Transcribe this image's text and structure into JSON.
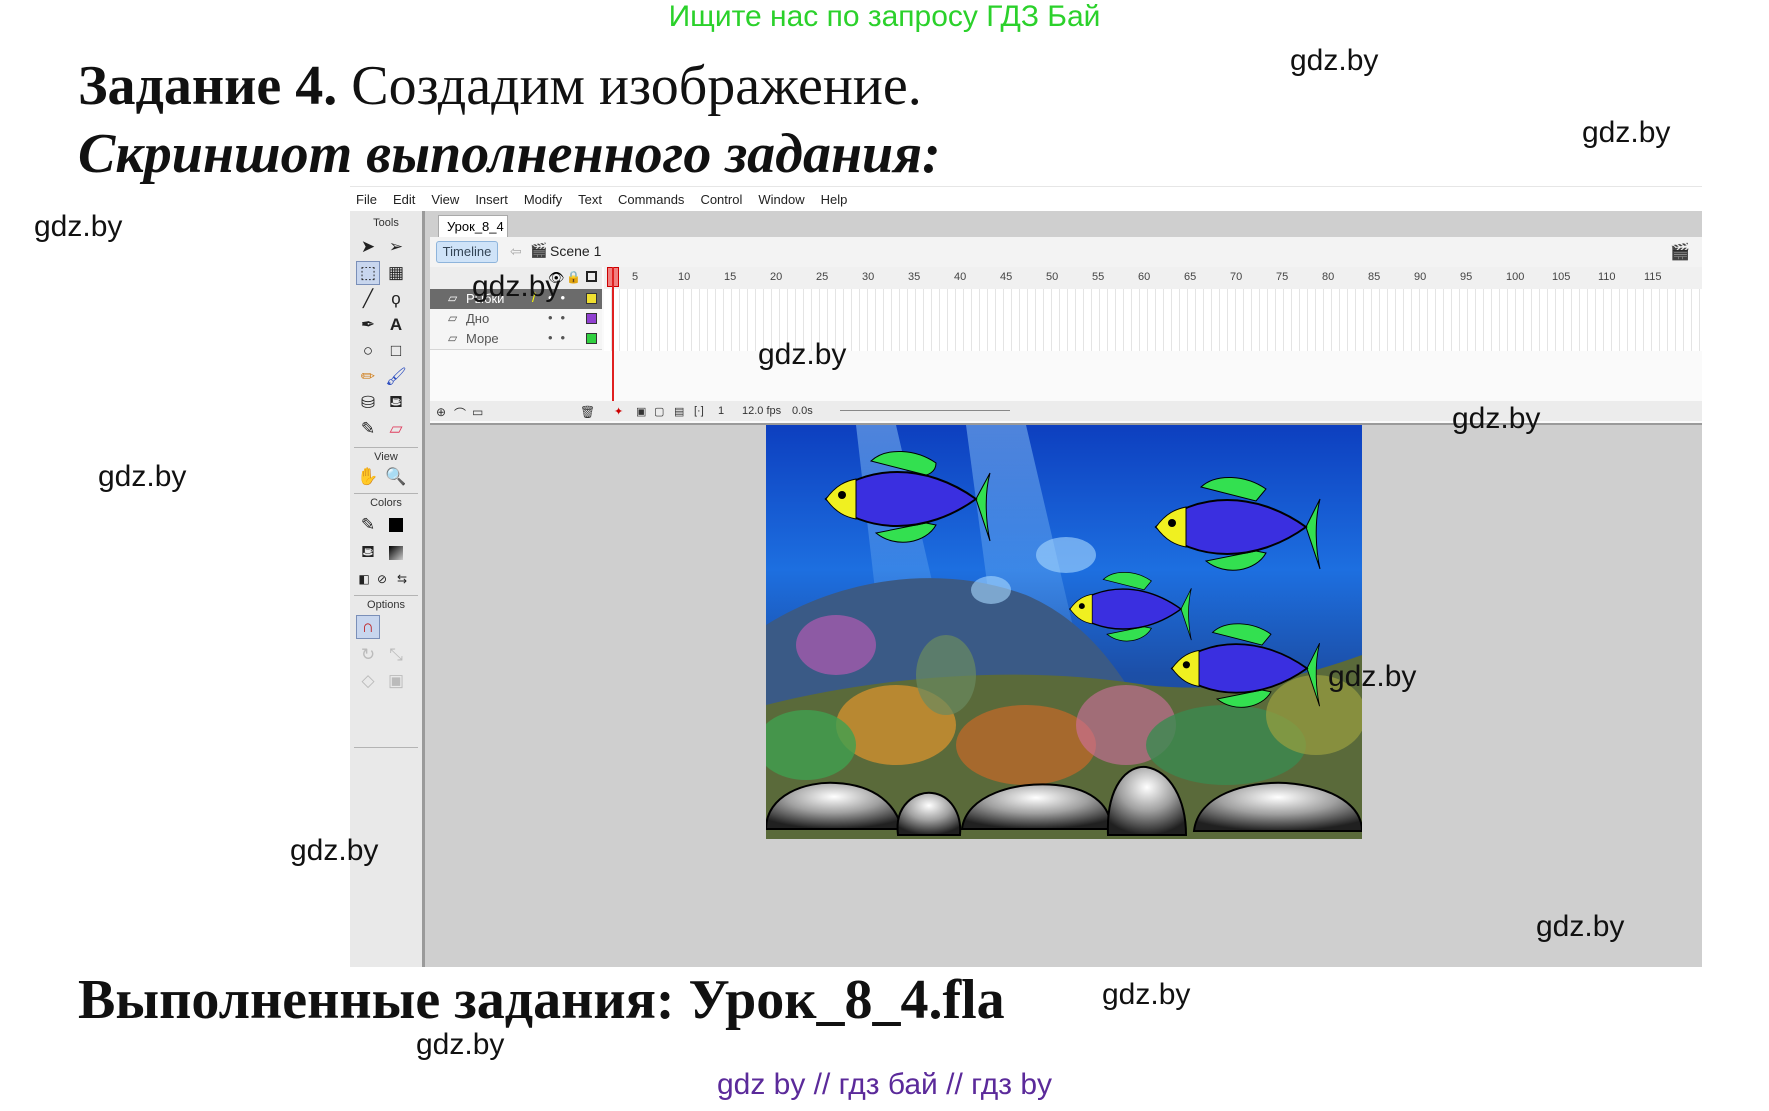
{
  "ad_text": "Ищите нас по запросу ГДЗ Бай",
  "heading": {
    "task_bold": "Задание 4.",
    "task_rest": " Создадим изображение.",
    "subtitle": "Скриншот выполненного задания:",
    "done": "Выполненные задания: Урок_8_4.fla"
  },
  "watermarks": [
    "gdz.by",
    "gdz.by",
    "gdz.by",
    "gdz.by",
    "gdz.by",
    "gdz.by",
    "gdz.by",
    "gdz.by",
    "gdz.by",
    "gdz.by",
    "gdz.by",
    "gdz.by"
  ],
  "footer": "gdz by  //  гдз бай  //  гдз by",
  "app": {
    "menu": [
      "File",
      "Edit",
      "View",
      "Insert",
      "Modify",
      "Text",
      "Commands",
      "Control",
      "Window",
      "Help"
    ],
    "tools": {
      "section_tools": "Tools",
      "section_view": "View",
      "section_colors": "Colors",
      "section_options": "Options"
    },
    "doc_tab": "Урок_8_4",
    "timeline_button": "Timeline",
    "scene_label": "Scene 1",
    "layers": [
      {
        "name": "Рыбки",
        "color": "#f0e030"
      },
      {
        "name": "Дно",
        "color": "#9040d0"
      },
      {
        "name": "Море",
        "color": "#30d040"
      }
    ],
    "ruler_ticks": [
      "5",
      "10",
      "15",
      "20",
      "25",
      "30",
      "35",
      "40",
      "45",
      "50",
      "55",
      "60",
      "65",
      "70",
      "75",
      "80",
      "85",
      "90",
      "95",
      "100",
      "105",
      "110",
      "115"
    ],
    "status": {
      "frame": "1",
      "fps": "12.0 fps",
      "time": "0.0s"
    }
  },
  "colors": {
    "fish_body": "#3a2fe0",
    "fish_fin": "#33e050",
    "fish_head": "#f0f020",
    "sea_top": "#1a4fd0"
  }
}
